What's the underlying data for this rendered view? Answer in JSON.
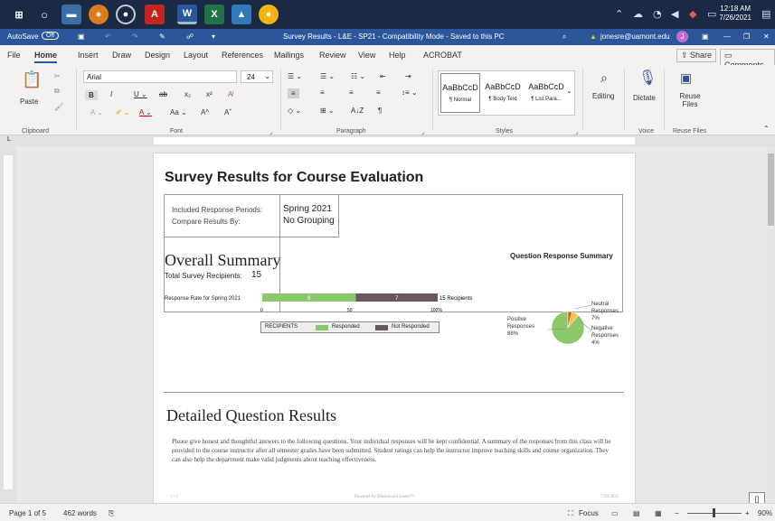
{
  "taskbar": {
    "time": "12:18 AM",
    "date": "7/26/2021"
  },
  "titlebar": {
    "autosave_label": "AutoSave",
    "autosave_state": "Off",
    "doc_title": "Survey Results - L&E - SP21 - Compatibility Mode - Saved to this PC",
    "user": "jonesre@uamont.edu",
    "avatar_initial": "J"
  },
  "menu": {
    "items": [
      "File",
      "Home",
      "Insert",
      "Draw",
      "Design",
      "Layout",
      "References",
      "Mailings",
      "Review",
      "View",
      "Help",
      "ACROBAT"
    ],
    "share": "Share",
    "comments": "Comments"
  },
  "ribbon": {
    "paste": "Paste",
    "clipboard": "Clipboard",
    "font_name": "Arial",
    "font_size": "24",
    "font": "Font",
    "paragraph": "Paragraph",
    "styles": [
      {
        "sample": "AaBbCcD",
        "name": "¶ Normal"
      },
      {
        "sample": "AaBbCcD",
        "name": "¶ Body Text"
      },
      {
        "sample": "AaBbCcD",
        "name": "¶ List Para..."
      }
    ],
    "styles_label": "Styles",
    "editing": "Editing",
    "dictate": "Dictate",
    "voice": "Voice",
    "reuse": "Reuse Files",
    "reuse_group": "Reuse Files"
  },
  "document": {
    "title": "Survey Results for Course Evaluation",
    "info": {
      "periods_label": "Included Response Periods:",
      "periods_value": "Spring 2021",
      "compare_label": "Compare Results By:",
      "compare_value": "No Grouping"
    },
    "overall": "Overall Summary",
    "recipients_label": "Total Survey Recipients:",
    "recipients_value": "15",
    "qrs_label": "Question Response Summary",
    "rate_label": "Response Rate for Spring 2021",
    "responded_count": "8",
    "not_responded_count": "7",
    "bar_total": "15 Recipients",
    "axis": [
      "0",
      "50",
      "100%"
    ],
    "legend": {
      "title": "RECIPIENTS",
      "responded": "Responded",
      "not_responded": "Not Responded"
    },
    "pie": {
      "positive_label": "Positive Responses",
      "positive_pct": "88%",
      "neutral_label": "Neutral Responses",
      "neutral_pct": "7%",
      "negative_label": "Negative Responses",
      "negative_pct": "4%"
    },
    "detailed": "Detailed Question Results",
    "paragraph": "Please give honest and thoughtful answers to the following questions. Your individual responses will be kept confidential. A summary of the responses from this class will be provided to the course instructor after all semester grades have been submitted. Student ratings can help the instructor improve teaching skills and course organization. They can also help the department make valid judgments about teaching effectiveness.",
    "footer_page": "1 / 5",
    "footer_powered": "Powered by Blackboard Learn™",
    "footer_date": "7/26/2021"
  },
  "status": {
    "page": "Page 1 of 5",
    "words": "462 words",
    "focus": "Focus",
    "zoom": "90%"
  },
  "colors": {
    "responded": "#8ac86a",
    "not_responded": "#6b5561",
    "pie_positive": "#8ac86a",
    "pie_neutral": "#f4c542",
    "pie_negative": "#e05a2a"
  }
}
